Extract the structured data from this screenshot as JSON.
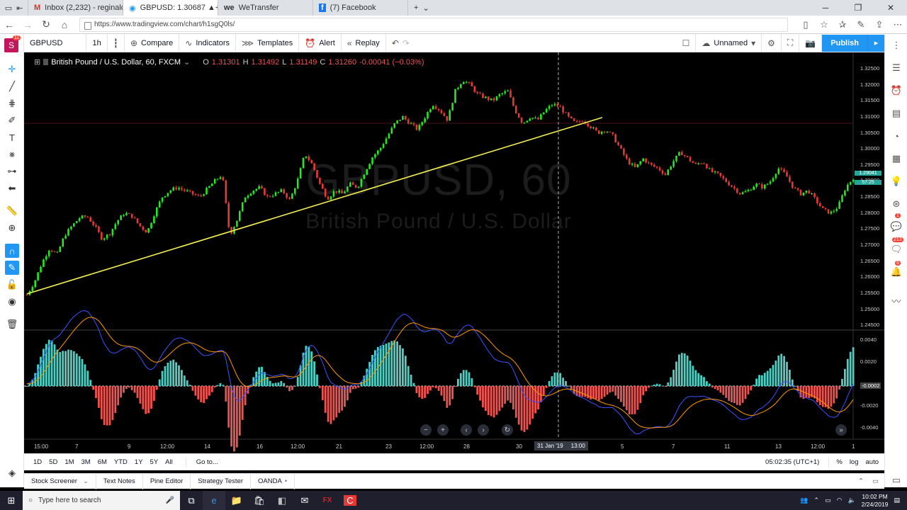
{
  "browser": {
    "tabs": [
      {
        "title": "Inbox (2,232) - reginaldstins",
        "icon": "gmail-icon"
      },
      {
        "title": "GBPUSD: 1.30687 ▲+0.",
        "icon": "tradingview-icon"
      },
      {
        "title": "WeTransfer",
        "icon": "wetransfer-icon"
      },
      {
        "title": "(7) Facebook",
        "icon": "facebook-icon"
      }
    ],
    "url": "https://www.tradingview.com/chart/h1sgQ0ls/"
  },
  "toolbar": {
    "symbol": "GBPUSD",
    "interval": "1h",
    "compare": "Compare",
    "indicators": "Indicators",
    "templates": "Templates",
    "alert": "Alert",
    "replay": "Replay",
    "layout_name": "Unnamed",
    "publish": "Publish"
  },
  "left_toolbar": {
    "avatar_letter": "S",
    "avatar_badge": "11"
  },
  "right_sidebar": {
    "badges": [
      "1",
      "213",
      "6"
    ]
  },
  "legend": {
    "title": "British Pound / U.S. Dollar, 60, FXCM",
    "o_label": "O",
    "o": "1.31301",
    "h_label": "H",
    "h": "1.31492",
    "l_label": "L",
    "l": "1.31149",
    "c_label": "C",
    "c": "1.31260",
    "change": "-0.00041 (−0.03%)"
  },
  "watermark": {
    "symbol": "GBPUSD, 60",
    "name": "British Pound / U.S. Dollar"
  },
  "chart_data": {
    "type": "candlestick",
    "symbol": "GBPUSD",
    "interval": "60",
    "price_ticks": [
      "1.32500",
      "1.32000",
      "1.31500",
      "1.31000",
      "1.30500",
      "1.30000",
      "1.29500",
      "1.29000",
      "1.28500",
      "1.28000",
      "1.27500",
      "1.27000",
      "1.26500",
      "1.26000",
      "1.25500",
      "1.25000",
      "1.24500"
    ],
    "price_range": [
      1.2435,
      1.327
    ],
    "last_price_tag": "1.29041",
    "countdown_tag": "57:25",
    "macd_ticks": [
      "0.0040",
      "0.0020",
      "-0.0002",
      "-0.0020",
      "-0.0040"
    ],
    "macd_range": [
      -0.005,
      0.0048
    ],
    "time_ticks": [
      "15:00",
      "7",
      "9",
      "12:00",
      "14",
      "16",
      "12:00",
      "21",
      "23",
      "12:00",
      "28",
      "30",
      "5",
      "7",
      "11",
      "13",
      "12:00",
      "1"
    ],
    "crosshair_time": "31 Jan '19",
    "crosshair_hour": "13:00",
    "price_path": [
      1.2545,
      1.2585,
      1.2645,
      1.269,
      1.267,
      1.273,
      1.276,
      1.2785,
      1.279,
      1.276,
      1.272,
      1.2735,
      1.2775,
      1.28,
      1.279,
      1.276,
      1.274,
      1.28,
      1.285,
      1.287,
      1.288,
      1.287,
      1.286,
      1.285,
      1.2875,
      1.29,
      1.292,
      1.273,
      1.278,
      1.285,
      1.287,
      1.288,
      1.285,
      1.286,
      1.287,
      1.284,
      1.29,
      1.2985,
      1.295,
      1.289,
      1.2845,
      1.287,
      1.286,
      1.289,
      1.288,
      1.293,
      1.2975,
      1.3,
      1.304,
      1.308,
      1.31,
      1.308,
      1.306,
      1.31,
      1.314,
      1.312,
      1.309,
      1.318,
      1.3215,
      1.32,
      1.317,
      1.316,
      1.315,
      1.317,
      1.318,
      1.312,
      1.308,
      1.31,
      1.309,
      1.312,
      1.314,
      1.313,
      1.31,
      1.308,
      1.309,
      1.307,
      1.305,
      1.306,
      1.304,
      1.3,
      1.296,
      1.294,
      1.297,
      1.295,
      1.294,
      1.292,
      1.296,
      1.299,
      1.297,
      1.295,
      1.296,
      1.293,
      1.292,
      1.29,
      1.288,
      1.286,
      1.287,
      1.289,
      1.288,
      1.29,
      1.294,
      1.292,
      1.288,
      1.286,
      1.287,
      1.284,
      1.281,
      1.28,
      1.282,
      1.288,
      1.291
    ]
  },
  "range_bar": {
    "ranges": [
      "1D",
      "5D",
      "1M",
      "3M",
      "6M",
      "YTD",
      "1Y",
      "5Y",
      "All"
    ],
    "goto": "Go to...",
    "time": "05:02:35 (UTC+1)",
    "percent": "%",
    "log": "log",
    "auto": "auto"
  },
  "panels": {
    "items": [
      "Stock Screener",
      "Text Notes",
      "Pine Editor",
      "Strategy Tester",
      "OANDA"
    ]
  },
  "taskbar": {
    "search_placeholder": "Type here to search",
    "time": "10:02 PM",
    "date": "2/24/2019"
  }
}
